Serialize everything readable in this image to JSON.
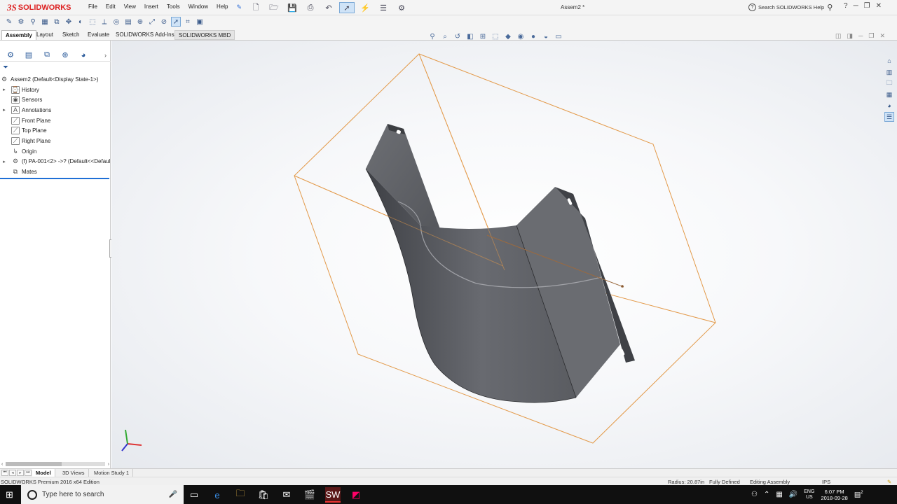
{
  "app": {
    "logo_ds": "3S",
    "logo_name": "SOLIDWORKS",
    "document_title": "Assem2 *"
  },
  "menu": [
    "File",
    "Edit",
    "View",
    "Insert",
    "Tools",
    "Window",
    "Help"
  ],
  "search": {
    "placeholder": "Search SOLIDWORKS Help"
  },
  "command_tabs": [
    "Assembly",
    "Layout",
    "Sketch",
    "Evaluate",
    "SOLIDWORKS Add-Ins",
    "SOLIDWORKS MBD"
  ],
  "tree": {
    "root": "Assem2  (Default<Display State-1>)",
    "items": [
      "History",
      "Sensors",
      "Annotations",
      "Front Plane",
      "Top Plane",
      "Right Plane",
      "Origin",
      "(f) PA-001<2> ->? (Default<<Defaul",
      "Mates"
    ]
  },
  "bottom_tabs": [
    "Model",
    "3D Views",
    "Motion Study 1"
  ],
  "status": {
    "edition": "SOLIDWORKS Premium 2016 x64 Edition",
    "radius": "Radius: 20.87in",
    "definition": "Fully Defined",
    "mode": "Editing Assembly",
    "units": "IPS"
  },
  "taskbar": {
    "search_placeholder": "Type here to search",
    "lang_1": "ENG",
    "lang_2": "US",
    "time": "6:07 PM",
    "date": "2018-09-28",
    "notif": "2"
  },
  "colors": {
    "accent": "#1f6fd6",
    "brand": "#d22222",
    "bounding_box": "#e39a4a",
    "part": "#5b5d62"
  }
}
